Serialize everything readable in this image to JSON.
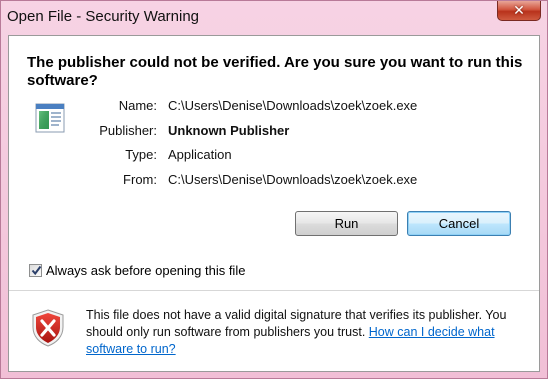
{
  "window": {
    "title": "Open File - Security Warning",
    "close_glyph": "✕"
  },
  "dialog": {
    "heading": "The publisher could not be verified.  Are you sure you want to run this software?",
    "info": {
      "name_label": "Name:",
      "name_value": "C:\\Users\\Denise\\Downloads\\zoek\\zoek.exe",
      "publisher_label": "Publisher:",
      "publisher_value": "Unknown Publisher",
      "type_label": "Type:",
      "type_value": "Application",
      "from_label": "From:",
      "from_value": "C:\\Users\\Denise\\Downloads\\zoek\\zoek.exe"
    },
    "buttons": {
      "run": "Run",
      "cancel": "Cancel"
    },
    "checkbox": {
      "label": "Always ask before opening this file",
      "checked": true
    },
    "warning": {
      "text": "This file does not have a valid digital signature that verifies its publisher. You should only run software from publishers you trust.",
      "link": "How can I decide what software to run?"
    }
  },
  "icons": {
    "file": "executable-file-icon",
    "shield": "security-shield-error-icon",
    "close": "close-icon",
    "check": "checkmark-icon"
  },
  "colors": {
    "window_frame": "#f1bfd6",
    "close_button": "#c8452c",
    "default_button": "#bee6fd",
    "link": "#0066cc",
    "shield_red": "#d0201a"
  }
}
